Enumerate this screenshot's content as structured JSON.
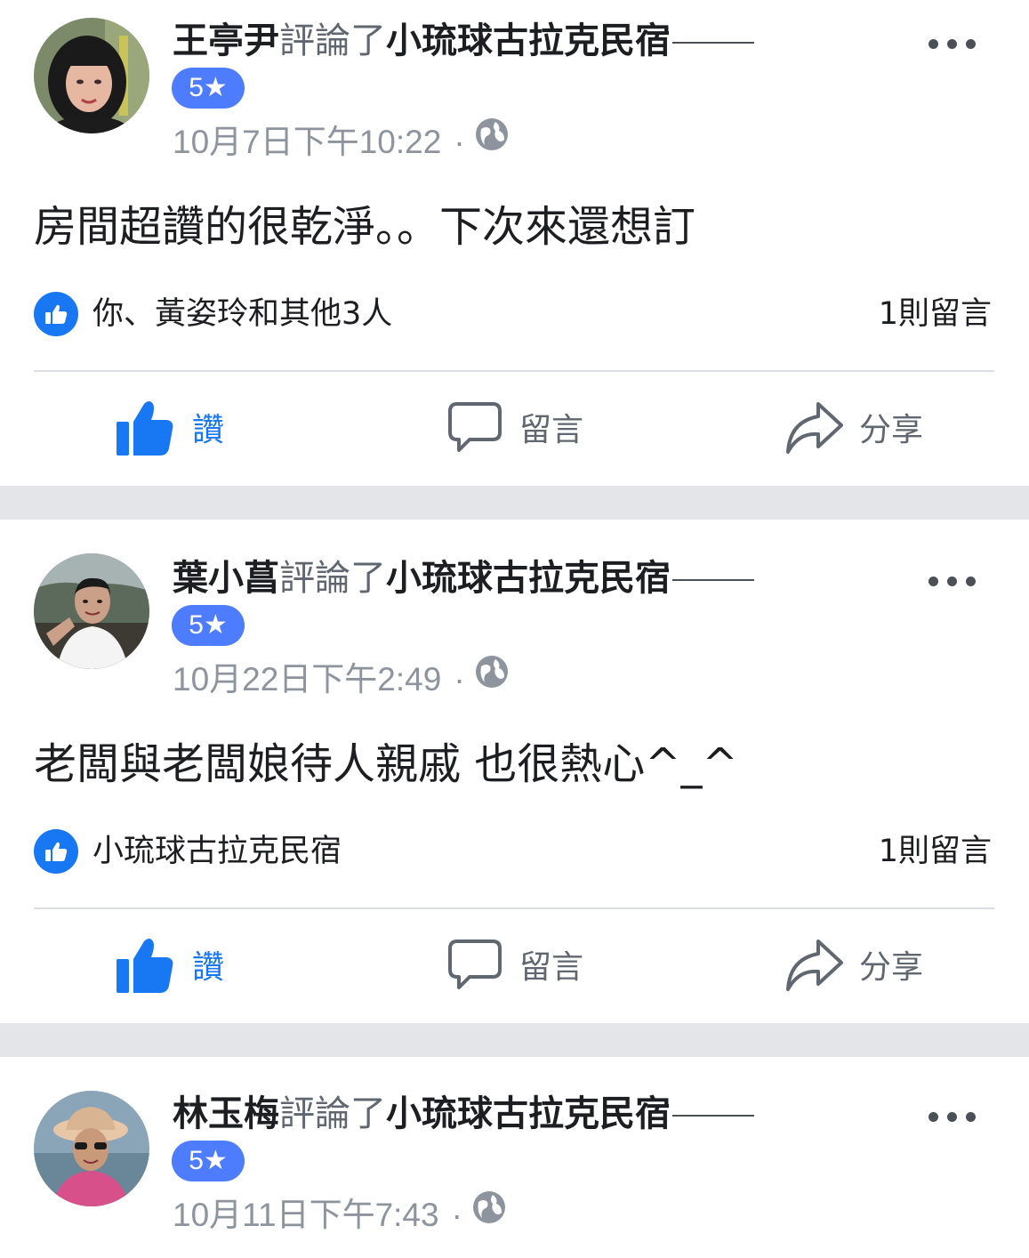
{
  "accent_color": "#1877f2",
  "rating_badge_color": "#4d7cfe",
  "separator_color": "#e4e5e8",
  "action_text": "評論了",
  "actions": {
    "like_label": "讚",
    "comment_label": "留言",
    "share_label": "分享"
  },
  "icons": {
    "more": "more-options-icon",
    "audience": "globe-icon",
    "like": "thumbs-up-icon",
    "comment": "comment-bubble-icon",
    "share": "share-arrow-icon"
  },
  "posts": [
    {
      "author": "王亭尹",
      "page": "小琉球古拉克民宿",
      "rating": "5★",
      "time": "10月7日下午10:22",
      "dot": "·",
      "text": "房間超讚的很乾淨。。下次來還想訂",
      "reactions": "你、黃姿玲和其他3人",
      "comments": "1則留言"
    },
    {
      "author": "葉小菖",
      "page": "小琉球古拉克民宿",
      "rating": "5★",
      "time": "10月22日下午2:49",
      "dot": "·",
      "text": "老闆與老闆娘待人親戚  也很熱心^_^",
      "reactions": "小琉球古拉克民宿",
      "comments": "1則留言"
    },
    {
      "author": "林玉梅",
      "page": "小琉球古拉克民宿",
      "rating": "5★",
      "time": "10月11日下午7:43",
      "dot": "·"
    }
  ]
}
